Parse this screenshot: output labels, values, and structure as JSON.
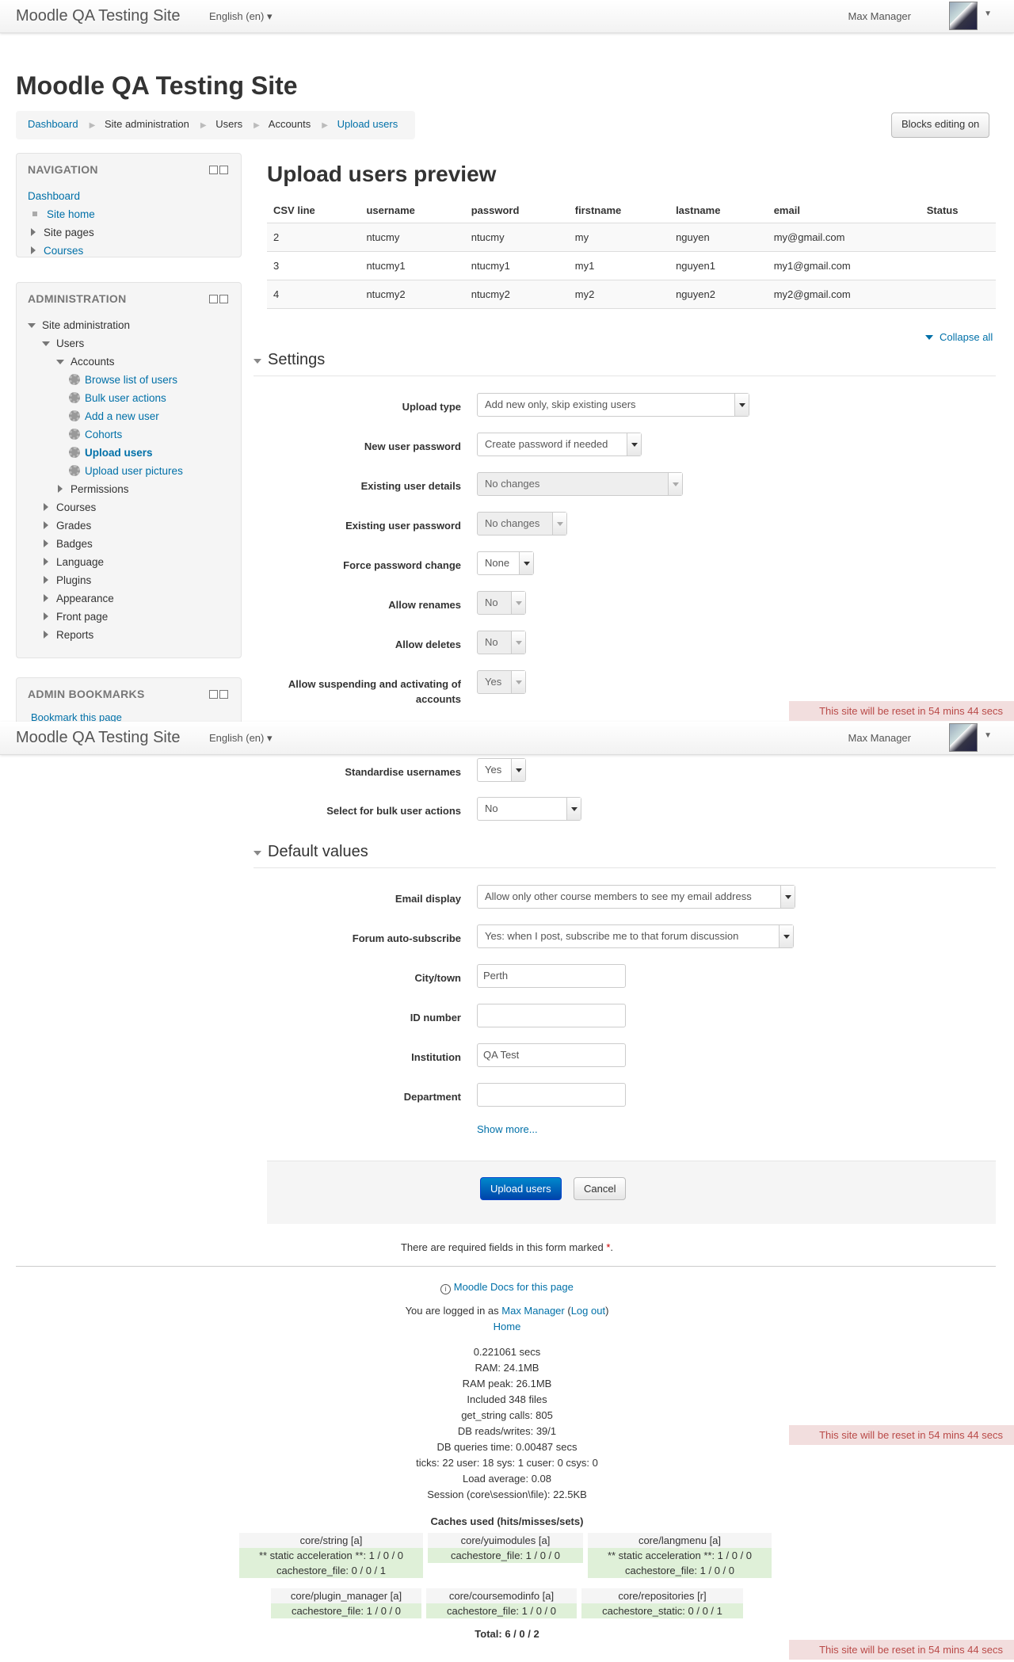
{
  "navbar": {
    "brand": "Moodle QA Testing Site",
    "language": "English (en) ▾",
    "user": "Max Manager"
  },
  "header": {
    "title": "Moodle QA Testing Site"
  },
  "breadcrumb": [
    "Dashboard",
    "Site administration",
    "Users",
    "Accounts",
    "Upload users"
  ],
  "blocks_editing_label": "Blocks editing on",
  "navigation": {
    "title": "NAVIGATION",
    "items": [
      "Dashboard",
      "Site home",
      "Site pages",
      "Courses"
    ]
  },
  "administration": {
    "title": "ADMINISTRATION",
    "site_admin": "Site administration",
    "users": "Users",
    "accounts": "Accounts",
    "account_items": [
      "Browse list of users",
      "Bulk user actions",
      "Add a new user",
      "Cohorts",
      "Upload users",
      "Upload user pictures"
    ],
    "permissions": "Permissions",
    "sections": [
      "Courses",
      "Grades",
      "Badges",
      "Language",
      "Plugins",
      "Appearance",
      "Front page",
      "Reports"
    ]
  },
  "bookmarks": {
    "title": "ADMIN BOOKMARKS",
    "link": "Bookmark this page"
  },
  "main": {
    "heading": "Upload users preview",
    "table": {
      "headers": [
        "CSV line",
        "username",
        "password",
        "firstname",
        "lastname",
        "email",
        "Status"
      ],
      "rows": [
        [
          "2",
          "ntucmy",
          "ntucmy",
          "my",
          "nguyen",
          "my@gmail.com",
          ""
        ],
        [
          "3",
          "ntucmy1",
          "ntucmy1",
          "my1",
          "nguyen1",
          "my1@gmail.com",
          ""
        ],
        [
          "4",
          "ntucmy2",
          "ntucmy2",
          "my2",
          "nguyen2",
          "my2@gmail.com",
          ""
        ]
      ]
    },
    "collapse_all": "Collapse all"
  },
  "settings": {
    "legend": "Settings",
    "upload_type": {
      "label": "Upload type",
      "value": "Add new only, skip existing users"
    },
    "new_user_password": {
      "label": "New user password",
      "value": "Create password if needed"
    },
    "existing_user_details": {
      "label": "Existing user details",
      "value": "No changes"
    },
    "existing_user_password": {
      "label": "Existing user password",
      "value": "No changes"
    },
    "force_password_change": {
      "label": "Force password change",
      "value": "None"
    },
    "allow_renames": {
      "label": "Allow renames",
      "value": "No"
    },
    "allow_deletes": {
      "label": "Allow deletes",
      "value": "No"
    },
    "allow_suspending": {
      "label": "Allow suspending and activating of accounts",
      "value": "Yes"
    },
    "standardise_usernames": {
      "label": "Standardise usernames",
      "value": "Yes"
    },
    "select_bulk": {
      "label": "Select for bulk user actions",
      "value": "No"
    }
  },
  "defaults": {
    "legend": "Default values",
    "email_display": {
      "label": "Email display",
      "value": "Allow only other course members to see my email address"
    },
    "forum_autosubscribe": {
      "label": "Forum auto-subscribe",
      "value": "Yes: when I post, subscribe me to that forum discussion"
    },
    "city": {
      "label": "City/town",
      "value": "Perth"
    },
    "idnumber": {
      "label": "ID number",
      "value": ""
    },
    "institution": {
      "label": "Institution",
      "value": "QA Test"
    },
    "department": {
      "label": "Department",
      "value": ""
    },
    "show_more": "Show more..."
  },
  "buttons": {
    "upload": "Upload users",
    "cancel": "Cancel"
  },
  "required_note": "There are required fields in this form marked",
  "required_mark": "*",
  "reset_banner": "This site will be reset in 54 mins 44 secs",
  "footer": {
    "docs": "Moodle Docs for this page",
    "logged_in_prefix": "You are logged in as",
    "logged_in_user": "Max Manager",
    "logout": "Log out",
    "home": "Home",
    "perf": [
      "0.221061 secs",
      "RAM: 24.1MB",
      "RAM peak: 26.1MB",
      "Included 348 files",
      "get_string calls: 805",
      "DB reads/writes: 39/1",
      "DB queries time: 0.00487 secs",
      "ticks: 22 user: 18 sys: 1 cuser: 0 csys: 0",
      "Load average: 0.08",
      "Session (core\\session\\file): 22.5KB"
    ],
    "caches_title": "Caches used (hits/misses/sets)",
    "caches": [
      {
        "name": "core/string [a]",
        "rows": [
          "** static acceleration **: 1 / 0 / 0",
          "cachestore_file: 0 / 0 / 1"
        ]
      },
      {
        "name": "core/yuimodules [a]",
        "rows": [
          "cachestore_file: 1 / 0 / 0"
        ]
      },
      {
        "name": "core/langmenu [a]",
        "rows": [
          "** static acceleration **: 1 / 0 / 0",
          "cachestore_file: 1 / 0 / 0"
        ]
      },
      {
        "name": "core/plugin_manager [a]",
        "rows": [
          "cachestore_file: 1 / 0 / 0"
        ]
      },
      {
        "name": "core/coursemodinfo [a]",
        "rows": [
          "cachestore_file: 1 / 0 / 0"
        ]
      },
      {
        "name": "core/repositories [r]",
        "rows": [
          "cachestore_static: 0 / 0 / 1"
        ]
      }
    ],
    "total": "Total: 6 / 0 / 2"
  }
}
